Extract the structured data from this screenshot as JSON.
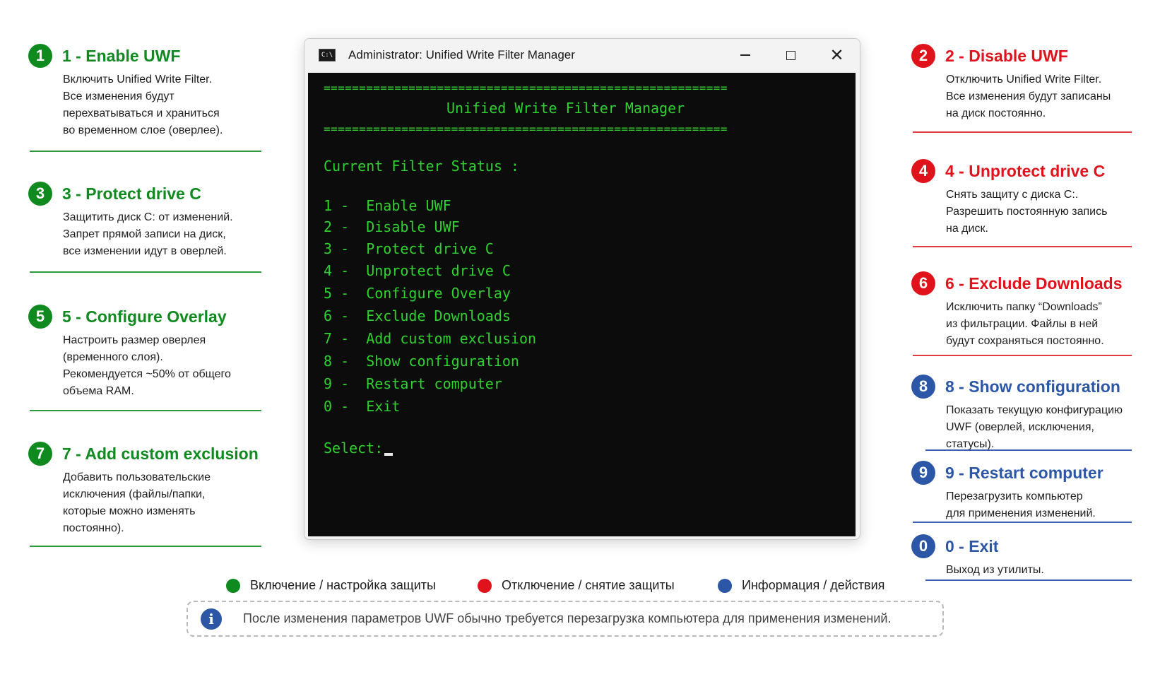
{
  "window": {
    "title": "Administrator:  Unified Write Filter Manager",
    "icon_text": "C:\\",
    "controls": {
      "minimize": "minimize-icon",
      "maximize": "maximize-icon",
      "close": "close-icon"
    }
  },
  "console": {
    "separator": "=========================================================",
    "header": "Unified Write Filter Manager",
    "status_label": "Current Filter Status :",
    "menu": [
      "1 -  Enable UWF",
      "2 -  Disable UWF",
      "3 -  Protect drive C",
      "4 -  Unprotect drive C",
      "5 -  Configure Overlay",
      "6 -  Exclude Downloads",
      "7 -  Add custom exclusion",
      "8 -  Show configuration",
      "9 -  Restart computer",
      "0 -  Exit"
    ],
    "prompt": "Select:"
  },
  "callouts": {
    "c1": {
      "num": "1",
      "title": "1 - Enable UWF",
      "desc": "Включить Unified Write Filter.\nВсе изменения будут\nперехватываться и храниться\nво временном слое (оверлее)."
    },
    "c3": {
      "num": "3",
      "title": "3 - Protect drive C",
      "desc": "Защитить диск C: от изменений.\nЗапрет прямой записи на диск,\nвсе изменении идут в оверлей."
    },
    "c5": {
      "num": "5",
      "title": "5 - Configure Overlay",
      "desc": "Настроить размер оверлея\n(временного слоя).\nРекомендуется ~50% от общего\nобъема RAM."
    },
    "c7": {
      "num": "7",
      "title": "7 - Add custom exclusion",
      "desc": "Добавить пользовательские\nисключения (файлы/папки,\nкоторые можно изменять\nпостоянно)."
    },
    "c2": {
      "num": "2",
      "title": "2 - Disable UWF",
      "desc": "Отключить Unified Write Filter.\nВсе изменения будут записаны\nна диск постоянно."
    },
    "c4": {
      "num": "4",
      "title": "4 - Unprotect drive C",
      "desc": "Снять защиту с диска C:.\nРазрешить постоянную запись\nна диск."
    },
    "c6": {
      "num": "6",
      "title": "6 - Exclude Downloads",
      "desc": "Исключить папку “Downloads”\nиз фильтрации. Файлы в ней\nбудут сохраняться постоянно."
    },
    "c8": {
      "num": "8",
      "title": "8 - Show configuration",
      "desc": "Показать текущую конфигурацию\nUWF (оверлей, исключения,\nстатусы)."
    },
    "c9": {
      "num": "9",
      "title": "9 - Restart computer",
      "desc": "Перезагрузить компьютер\nдля применения изменений."
    },
    "c0": {
      "num": "0",
      "title": "0 - Exit",
      "desc": "Выход из утилиты."
    }
  },
  "legend": {
    "green": "Включение / настройка защиты",
    "red": "Отключение / снятие защиты",
    "blue": "Информация / действия"
  },
  "note": {
    "icon": "info-icon",
    "text": "После изменения параметров UWF обычно требуется перезагрузка компьютера для применения изменений."
  },
  "colors": {
    "green": "#0f8a1f",
    "red": "#e0131c",
    "blue": "#2c56a6",
    "console_bg": "#0c0c0c",
    "console_text": "#2fd12f"
  }
}
